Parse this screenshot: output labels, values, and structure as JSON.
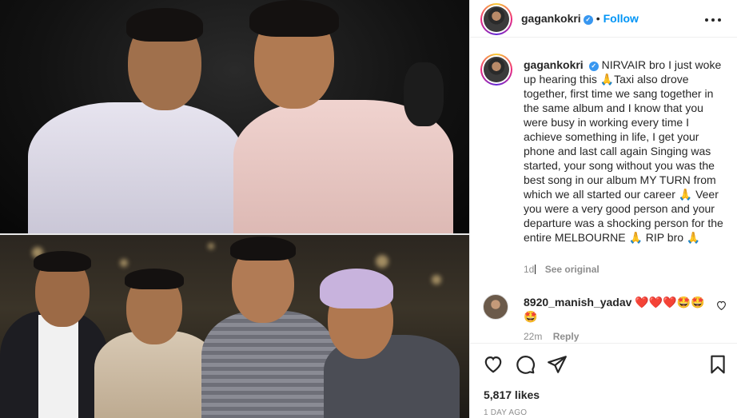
{
  "post": {
    "username": "gagankokri",
    "verified_mark": "✓",
    "follow_label": "Follow",
    "separator": "•",
    "more_label": "•••"
  },
  "caption": {
    "username": "gagankokri",
    "text": "NIRVAIR bro I just woke up hearing this 🙏Taxi also drove together, first time we sang together in the same album and I know that you were busy in working every time I achieve something in life, I get your phone and last call again Singing was started, your song without you was the best song in our album MY TURN from which we all started our career 🙏 Veer you were a very good person and your departure was a shocking person for the entire MELBOURNE 🙏 RIP bro 🙏",
    "age": "1d",
    "see_original": "See original"
  },
  "comment": {
    "username": "8920_manish_yadav",
    "text": "❤️❤️❤️🤩🤩🤩",
    "age": "22m",
    "reply_label": "Reply"
  },
  "actions": {
    "likes": "5,817 likes",
    "time": "1 DAY AGO"
  },
  "icons": [
    "heart-icon",
    "comment-icon",
    "share-icon",
    "bookmark-icon",
    "more-icon",
    "verified-icon"
  ],
  "colors": {
    "accent": "#0095f6",
    "verified": "#3897f0",
    "muted": "#8e8e8e",
    "text": "#262626"
  }
}
